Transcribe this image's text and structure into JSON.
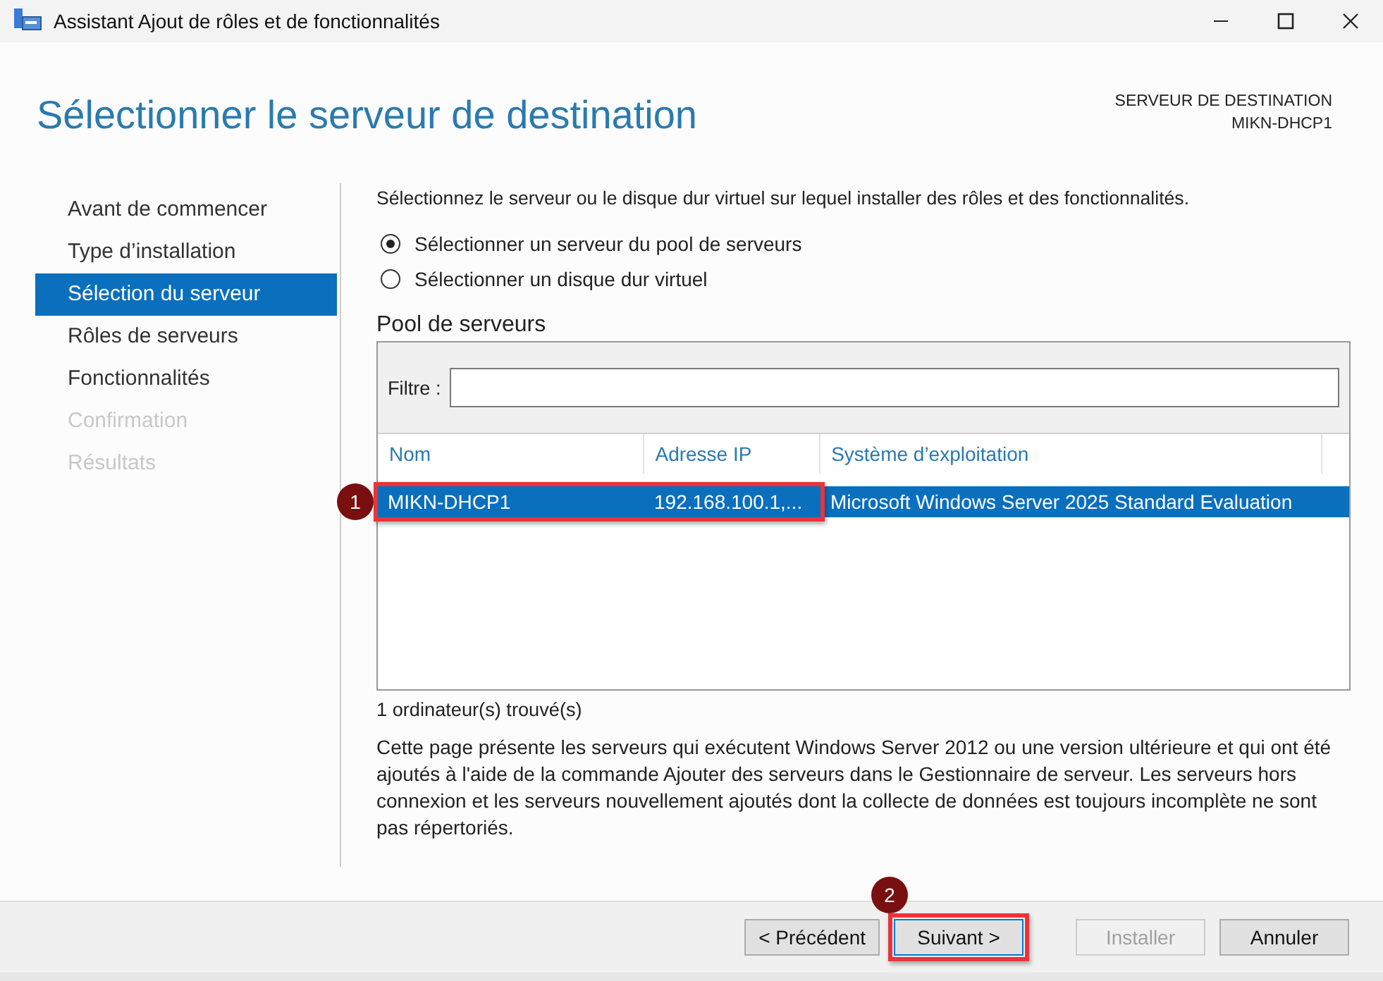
{
  "window": {
    "title": "Assistant Ajout de rôles et de fonctionnalités"
  },
  "header": {
    "title": "Sélectionner le serveur de destination",
    "destination_label": "SERVEUR DE DESTINATION",
    "destination_server": "MIKN-DHCP1"
  },
  "sidebar": {
    "items": [
      {
        "label": "Avant de commencer",
        "selected": false,
        "disabled": false
      },
      {
        "label": "Type d’installation",
        "selected": false,
        "disabled": false
      },
      {
        "label": "Sélection du serveur",
        "selected": true,
        "disabled": false
      },
      {
        "label": "Rôles de serveurs",
        "selected": false,
        "disabled": false
      },
      {
        "label": "Fonctionnalités",
        "selected": false,
        "disabled": false
      },
      {
        "label": "Confirmation",
        "selected": false,
        "disabled": true
      },
      {
        "label": "Résultats",
        "selected": false,
        "disabled": true
      }
    ]
  },
  "intro": "Sélectionnez le serveur ou le disque dur virtuel sur lequel installer des rôles et des fonctionnalités.",
  "options": [
    {
      "label": "Sélectionner un serveur du pool de serveurs",
      "selected": true
    },
    {
      "label": "Sélectionner un disque dur virtuel",
      "selected": false
    }
  ],
  "pool": {
    "title": "Pool de serveurs",
    "filter_label": "Filtre :",
    "columns": [
      "Nom",
      "Adresse IP",
      "Système d’exploitation"
    ],
    "rows": [
      {
        "cells": [
          "MIKN-DHCP1",
          "192.168.100.1,...",
          "Microsoft Windows Server 2025 Standard Evaluation"
        ],
        "selected": true,
        "annotation": "1"
      }
    ],
    "count": "1 ordinateur(s) trouvé(s)"
  },
  "note": "Cette page présente les serveurs qui exécutent Windows Server 2012 ou une version ultérieure et qui ont été ajoutés à l'aide de la commande Ajouter des serveurs dans le Gestionnaire de serveur. Les serveurs hors connexion et les serveurs nouvellement ajoutés dont la collecte de données est toujours incomplète ne sont pas répertoriés.",
  "buttons": [
    {
      "label": "< Précédent",
      "disabled": false,
      "default": false
    },
    {
      "label": "Suivant >",
      "disabled": false,
      "default": true,
      "annotation": "2"
    },
    {
      "label": "Installer",
      "disabled": true,
      "default": false
    },
    {
      "label": "Annuler",
      "disabled": false,
      "default": false
    }
  ]
}
